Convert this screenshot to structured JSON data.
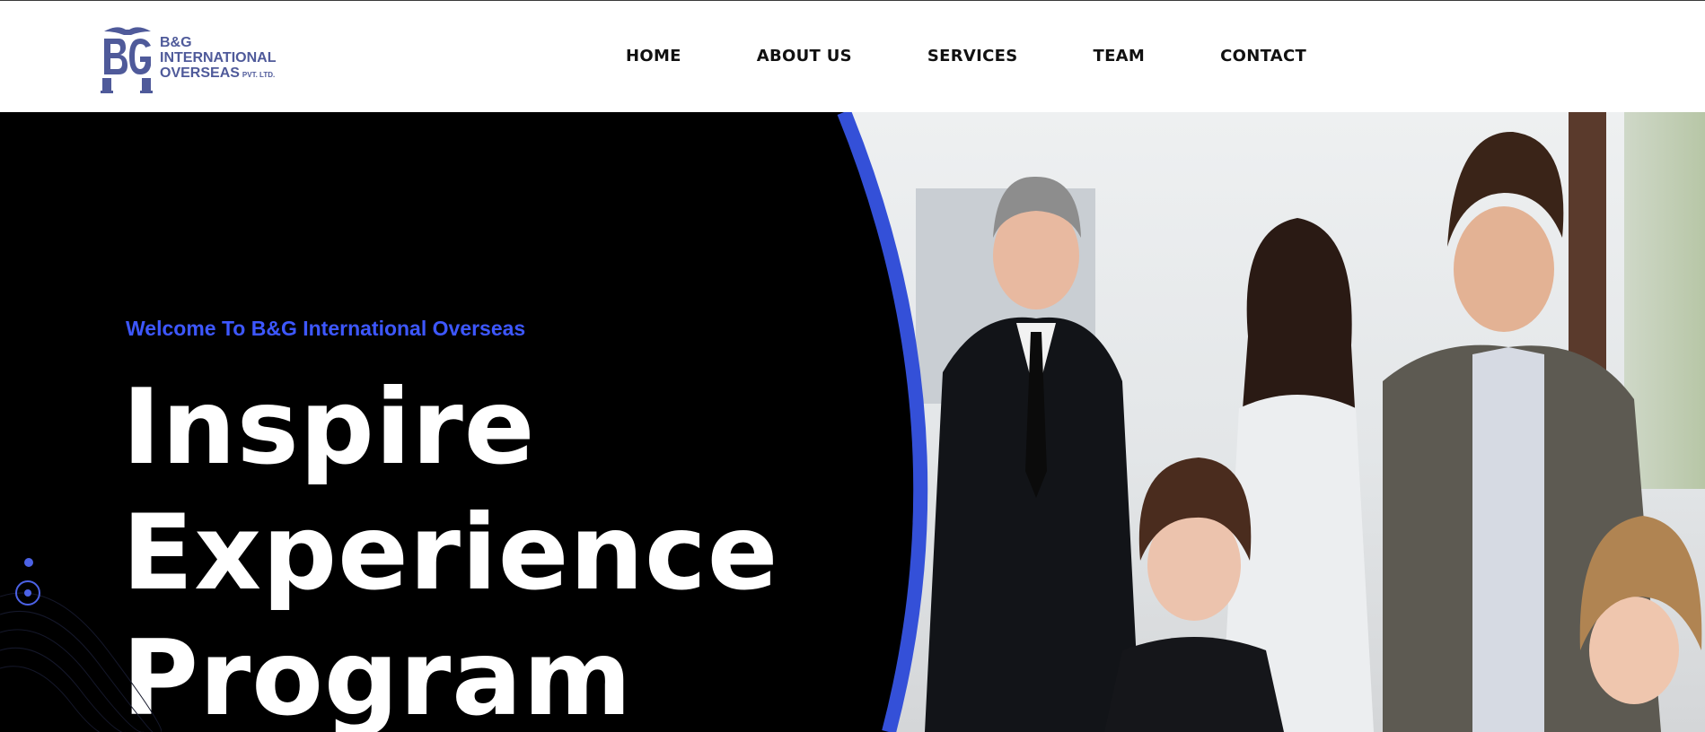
{
  "header": {
    "logo": {
      "mark": "B&G",
      "line1": "B&G",
      "line2": "INTERNATIONAL",
      "line3": "OVERSEAS",
      "suffix": "PVT. LTD.",
      "color": "#4f5a9a"
    },
    "nav": [
      {
        "label": "HOME"
      },
      {
        "label": "ABOUT US"
      },
      {
        "label": "SERVICES"
      },
      {
        "label": "TEAM"
      },
      {
        "label": "CONTACT"
      }
    ]
  },
  "hero": {
    "welcome": "Welcome To B&G International Overseas",
    "headline": [
      "Inspire",
      "Experience",
      "Program"
    ],
    "accent_color": "#3d57ff",
    "arc_color": "#3450d8",
    "background_color": "#000000",
    "photo": "team-meeting-photo"
  }
}
